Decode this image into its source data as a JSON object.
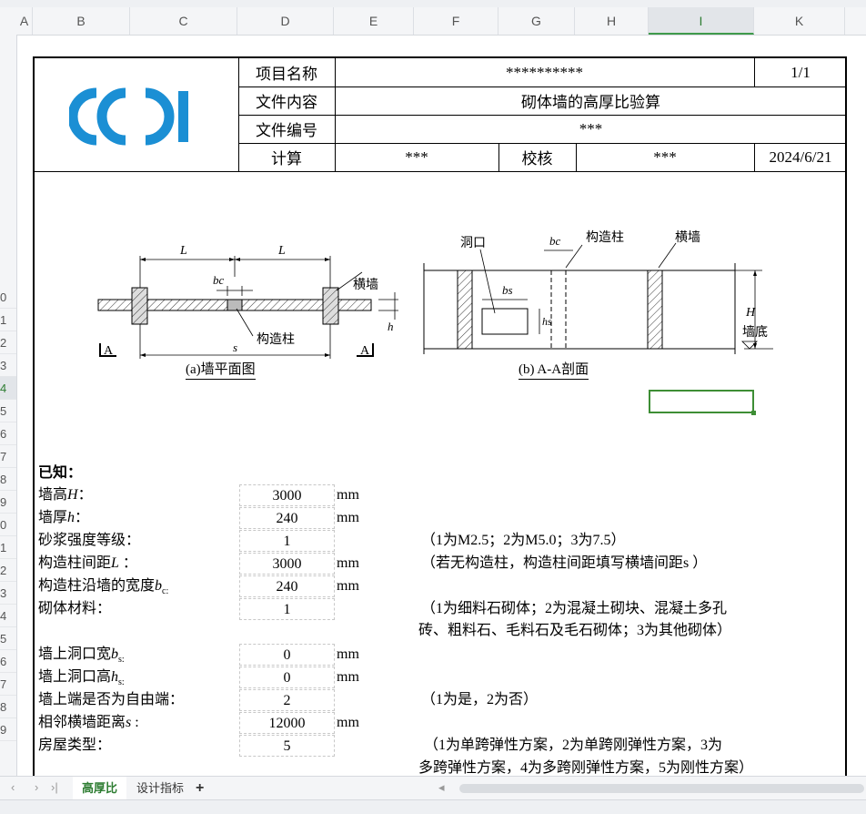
{
  "columns": [
    "A",
    "B",
    "C",
    "D",
    "E",
    "F",
    "G",
    "H",
    "I",
    "K"
  ],
  "active_column": "I",
  "rows": [
    "0",
    "1",
    "2",
    "3",
    "4",
    "5",
    "6",
    "7",
    "8",
    "9",
    "0",
    "1",
    "2",
    "3",
    "4",
    "5",
    "6",
    "7",
    "8",
    "9"
  ],
  "active_row": "4",
  "header": {
    "project_name_label": "项目名称",
    "project_name_value": "**********",
    "page": "1/1",
    "file_content_label": "文件内容",
    "file_content_value": "砌体墙的高厚比验算",
    "file_number_label": "文件编号",
    "file_number_value": "***",
    "calc_label": "计算",
    "calc_value": "***",
    "check_label": "校核",
    "check_value": "***",
    "date": "2024/6/21"
  },
  "logo": {
    "text": "CCDI",
    "color": "#1b8fd4"
  },
  "diagram_a": {
    "L1": "L",
    "L2": "L",
    "bc": "bc",
    "cross_wall": "横墙",
    "column": "构造柱",
    "s": "s",
    "h": "h",
    "A_left": "A",
    "A_right": "A",
    "caption": "(a)墙平面图"
  },
  "diagram_b": {
    "opening": "洞口",
    "bc": "bc",
    "column": "构造柱",
    "cross_wall": "横墙",
    "bs": "bs",
    "hs": "hs",
    "H": "H",
    "wall_bottom": "墙底",
    "caption": "(b)  A-A剖面"
  },
  "known_title": "已知：",
  "params": [
    {
      "label": "墙高",
      "sym": "H",
      "suffix": "：",
      "value": "3000",
      "unit": "mm",
      "note": ""
    },
    {
      "label": "墙厚",
      "sym": "h",
      "suffix": "：",
      "value": "240",
      "unit": "mm",
      "note": ""
    },
    {
      "label": "砂浆强度等级：",
      "sym": "",
      "suffix": "",
      "value": "1",
      "unit": "",
      "note": "（1为M2.5；2为M5.0；3为7.5）"
    },
    {
      "label": "构造柱间距",
      "sym": "L",
      "suffix": " ：",
      "value": "3000",
      "unit": "mm",
      "note": "（若无构造柱，构造柱间距填写横墙间距s ）"
    },
    {
      "label": "构造柱沿墙的宽度",
      "sym": "b",
      "suffix": "c:",
      "value": "240",
      "unit": "mm",
      "note": ""
    },
    {
      "label": "砌体材料：",
      "sym": "",
      "suffix": "",
      "value": "1",
      "unit": "",
      "note": "（1为细料石砌体；2为混凝土砌块、混凝土多孔",
      "note2": "砖、粗料石、毛料石及毛石砌体；3为其他砌体）"
    },
    {
      "label": "墙上洞口宽",
      "sym": "b",
      "suffix": "s:",
      "value": "0",
      "unit": "mm",
      "note": ""
    },
    {
      "label": "墙上洞口高",
      "sym": "h",
      "suffix": "s:",
      "value": "0",
      "unit": "mm",
      "note": ""
    },
    {
      "label": "墙上端是否为自由端：",
      "sym": "",
      "suffix": "",
      "value": "2",
      "unit": "",
      "note": "（1为是，2为否）"
    },
    {
      "label": "相邻横墙距离",
      "sym": "s",
      "suffix": " :",
      "value": "12000",
      "unit": "mm",
      "note": ""
    },
    {
      "label": "房屋类型：",
      "sym": "",
      "suffix": "",
      "value": "5",
      "unit": "",
      "note": "（1为单跨弹性方案，2为单跨刚弹性方案，3为",
      "note2": "多跨弹性方案，4为多跨刚弹性方案，5为刚性方案）"
    }
  ],
  "tabs": {
    "first": "高厚比",
    "second": "设计指标",
    "add": "+"
  }
}
